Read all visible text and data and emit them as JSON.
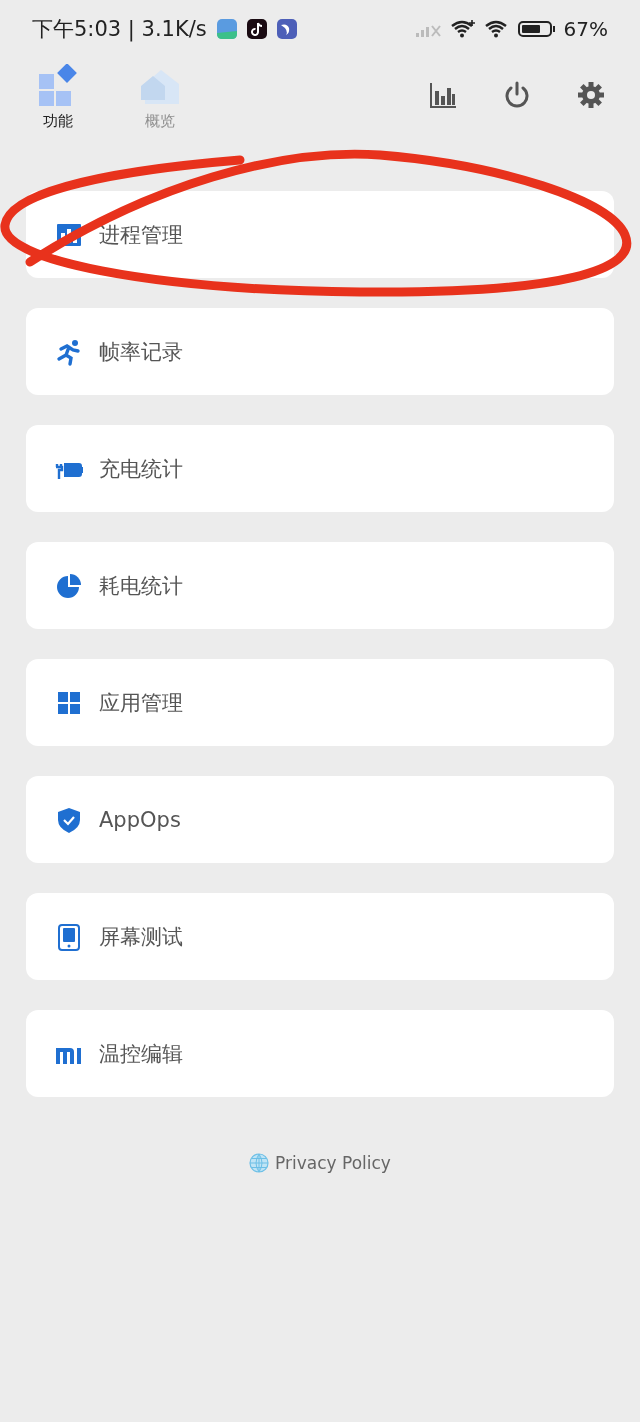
{
  "status_bar": {
    "time": "下午5:03 | 3.1K/s",
    "battery": "67%"
  },
  "tabs": [
    {
      "label": "功能",
      "selected": true
    },
    {
      "label": "概览",
      "selected": false
    }
  ],
  "menu_items": [
    {
      "label": "进程管理"
    },
    {
      "label": "帧率记录"
    },
    {
      "label": "充电统计"
    },
    {
      "label": "耗电统计"
    },
    {
      "label": "应用管理"
    },
    {
      "label": "AppOps"
    },
    {
      "label": "屏幕测试"
    },
    {
      "label": "温控编辑"
    }
  ],
  "footer": {
    "link": "Privacy Policy"
  }
}
